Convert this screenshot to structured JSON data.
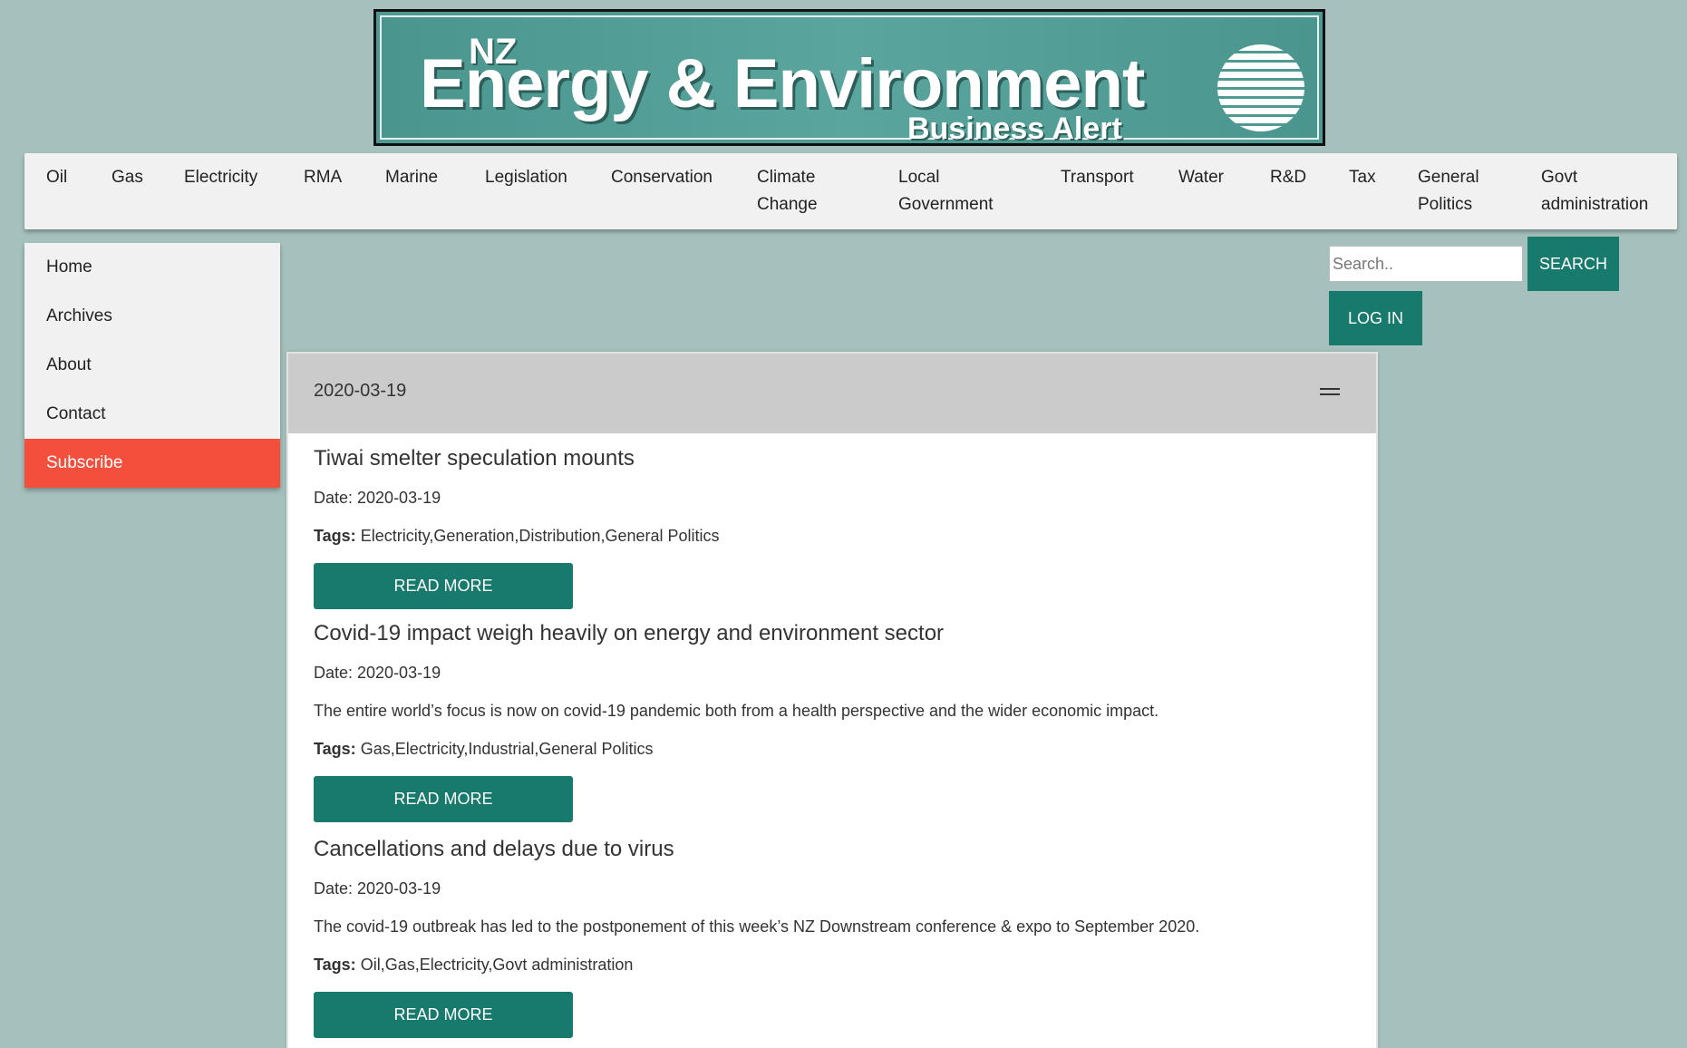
{
  "banner": {
    "nz": "NZ",
    "title": "Energy & Environment",
    "subtitle": "Business Alert",
    "globe_icon": "globe-icon"
  },
  "topnav": [
    {
      "label": "Oil"
    },
    {
      "label": "Gas"
    },
    {
      "label": "Electricity"
    },
    {
      "label": "RMA"
    },
    {
      "label": "Marine"
    },
    {
      "label": "Legislation"
    },
    {
      "label": "Conservation"
    },
    {
      "label": "Climate Change"
    },
    {
      "label": "Local Government"
    },
    {
      "label": "Transport"
    },
    {
      "label": "Water"
    },
    {
      "label": "R&D"
    },
    {
      "label": "Tax"
    },
    {
      "label": "General Politics"
    },
    {
      "label": "Govt administration"
    }
  ],
  "sidemenu": [
    {
      "label": "Home"
    },
    {
      "label": "Archives"
    },
    {
      "label": "About"
    },
    {
      "label": "Contact"
    },
    {
      "label": "Subscribe"
    }
  ],
  "search": {
    "placeholder": "Search..",
    "button": "SEARCH"
  },
  "login_label": "LOG IN",
  "panel": {
    "date": "2020-03-19",
    "tags_label": "Tags:",
    "read_more": "READ MORE",
    "articles": [
      {
        "title": "Tiwai smelter speculation mounts",
        "date": "Date: 2020-03-19",
        "summary": "",
        "tags": "Electricity,Generation,Distribution,General Politics"
      },
      {
        "title": "Covid-19 impact weigh heavily on energy and environment sector",
        "date": "Date: 2020-03-19",
        "summary": "The entire world’s focus is now on covid-19 pandemic both from a health perspective and the wider economic impact.",
        "tags": "Gas,Electricity,Industrial,General Politics"
      },
      {
        "title": "Cancellations and delays due to virus",
        "date": "Date: 2020-03-19",
        "summary": "The covid-19 outbreak has led to the postponement of this week’s NZ Downstream conference & expo to September 2020.",
        "tags": "Oil,Gas,Electricity,Govt administration"
      }
    ]
  },
  "colors": {
    "background": "#a6c1bd",
    "accent": "#187a6c",
    "subscribe": "#f44f3c"
  }
}
